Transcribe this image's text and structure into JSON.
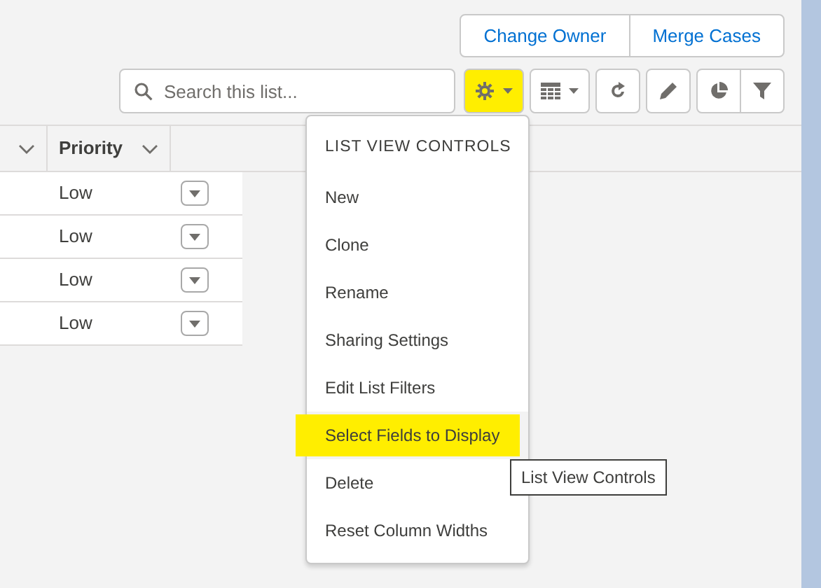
{
  "header_actions": [
    {
      "label": "Change Owner"
    },
    {
      "label": "Merge Cases"
    }
  ],
  "search": {
    "placeholder": "Search this list..."
  },
  "toolbar": [
    {
      "kind": "settings",
      "highlighted": true
    },
    {
      "kind": "table",
      "highlighted": false
    },
    {
      "kind": "refresh",
      "highlighted": false
    },
    {
      "kind": "edit",
      "highlighted": false
    },
    {
      "kind": "chart",
      "highlighted": false
    },
    {
      "kind": "filter",
      "highlighted": false
    }
  ],
  "table": {
    "columns": [
      {
        "kind": "unlabeled"
      },
      {
        "kind": "labeled",
        "label": "Priority"
      }
    ],
    "rows": [
      {
        "priority": "Low"
      },
      {
        "priority": "Low"
      },
      {
        "priority": "Low"
      },
      {
        "priority": "Low"
      }
    ]
  },
  "menu": {
    "title": "LIST VIEW CONTROLS",
    "items": [
      {
        "label": "New",
        "selected": false,
        "highlighted": false
      },
      {
        "label": "Clone",
        "selected": false,
        "highlighted": false
      },
      {
        "label": "Rename",
        "selected": false,
        "highlighted": false
      },
      {
        "label": "Sharing Settings",
        "selected": false,
        "highlighted": false
      },
      {
        "label": "Edit List Filters",
        "selected": false,
        "highlighted": false
      },
      {
        "label": "Select Fields to Display",
        "selected": true,
        "highlighted": true
      },
      {
        "label": "Delete",
        "selected": false,
        "highlighted": false
      },
      {
        "label": "Reset Column Widths",
        "selected": false,
        "highlighted": false
      }
    ]
  },
  "tooltip": {
    "text": "List View Controls"
  }
}
